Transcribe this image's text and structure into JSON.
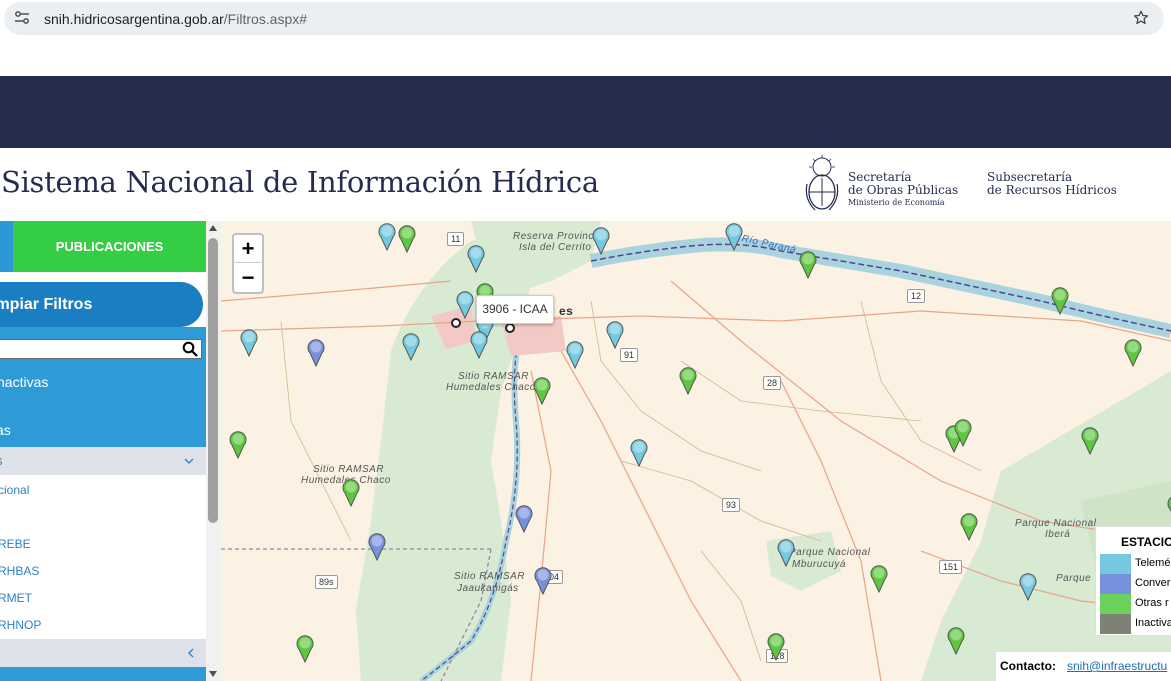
{
  "browser": {
    "url_host": "snih.hidricosargentina.gob.ar",
    "url_path": "/Filtros.aspx#"
  },
  "header": {
    "title": "Sistema Nacional de Información Hídrica",
    "secretaria_line1": "Secretaría",
    "secretaria_line2": "de Obras Públicas",
    "secretaria_line3": "Ministerio de Economía",
    "subsecretaria_line1": "Subsecretaría",
    "subsecretaria_line2": "de Recursos Hídricos"
  },
  "sidebar": {
    "publicaciones": "PUBLICACIONES",
    "limpiar_filtros": "impiar Filtros",
    "search_value": "",
    "text_inactivas": "nactivas",
    "text_as": "as",
    "group_label": "s",
    "links": [
      "cional",
      "REBE",
      "RHBAS",
      "RMET",
      "RHNOP"
    ]
  },
  "map": {
    "zoom_in": "+",
    "zoom_out": "−",
    "tooltip": "3906 - ICAA",
    "city_fragment": "es",
    "labels": {
      "reserva": "Reserva Provincial",
      "isla": "Isla del Cerrito",
      "rio": "Río Paraná",
      "ramsar1a": "Sitio RAMSAR",
      "ramsar1b": "Humedales Chaco",
      "ramsar2a": "Sitio RAMSAR",
      "ramsar2b": "Humedales Chaco",
      "ramsar3a": "Sitio RAMSAR",
      "ramsar3b": "Jaaukanigás",
      "mburucuya_a": "Parque Nacional",
      "mburucuya_b": "Mburucuyá",
      "ibera_a": "Parque Nacional",
      "ibera_b": "Iberá",
      "parque_c": "Parque"
    },
    "routes": [
      "11",
      "12",
      "91",
      "28",
      "93",
      "104",
      "89s",
      "151",
      "118"
    ],
    "legend": {
      "title": "ESTACIO",
      "items": [
        {
          "label": "Telemé",
          "color": "#74c8df"
        },
        {
          "label": "Conver",
          "color": "#7891dd"
        },
        {
          "label": "Otras r",
          "color": "#6ad15a"
        },
        {
          "label": "Inactiva",
          "color": "#7c8276"
        }
      ]
    },
    "contact_label": "Contacto:",
    "contact_email": "snih@infraestructu"
  },
  "colors": {
    "navy": "#252d4f",
    "publicaciones_green": "#35cd44",
    "sidebar_blue": "#2e9bd7",
    "clear_blue": "#1a7ec3",
    "marker_telemetria": "#74c8df",
    "marker_convencional": "#7891dd",
    "marker_otras": "#5fc63f"
  }
}
